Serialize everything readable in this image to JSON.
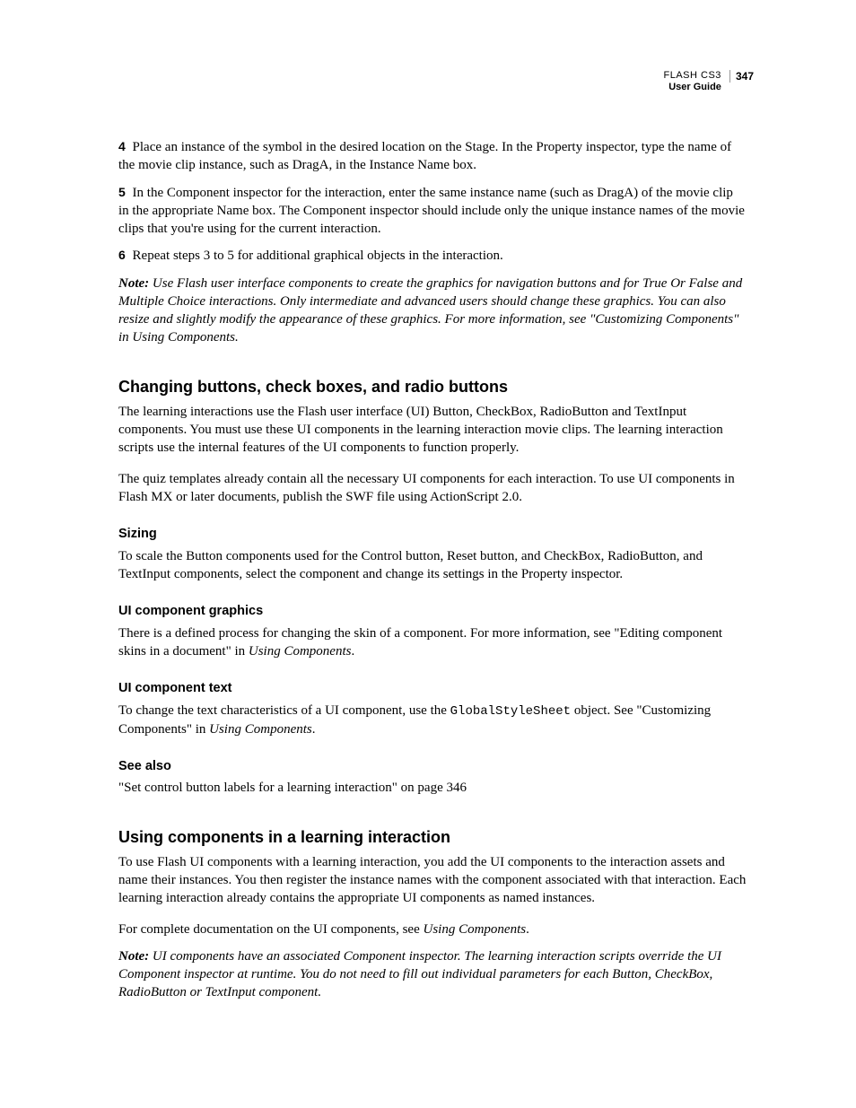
{
  "header": {
    "product": "FLASH CS3",
    "page_number": "347",
    "guide": "User Guide"
  },
  "steps": {
    "s4": {
      "num": "4",
      "text": "Place an instance of the symbol in the desired location on the Stage. In the Property inspector, type the name of the movie clip instance, such as DragA, in the Instance Name box."
    },
    "s5": {
      "num": "5",
      "text": "In the Component inspector for the interaction, enter the same instance name (such as DragA) of the movie clip in the appropriate Name box. The Component inspector should include only the unique instance names of the movie clips that you're using for the current interaction."
    },
    "s6": {
      "num": "6",
      "text": "Repeat steps 3 to 5 for additional graphical objects in the interaction."
    }
  },
  "note1": {
    "label": "Note:",
    "text": " Use Flash user interface components to create the graphics for navigation buttons and for True Or False and Multiple Choice interactions. Only intermediate and advanced users should change these graphics. You can also resize and slightly modify the appearance of these graphics. For more information, see \"Customizing Components\" in Using Components."
  },
  "section_changing": {
    "heading": "Changing buttons, check boxes, and radio buttons",
    "p1": "The learning interactions use the Flash user interface (UI) Button, CheckBox, RadioButton and TextInput components. You must use these UI components in the learning interaction movie clips. The learning interaction scripts use the internal features of the UI components to function properly.",
    "p2": "The quiz templates already contain all the necessary UI components for each interaction. To use UI components in Flash MX or later documents, publish the SWF file using ActionScript 2.0."
  },
  "sizing": {
    "heading": "Sizing",
    "p": "To scale the Button components used for the Control button, Reset button, and CheckBox, RadioButton, and TextInput components, select the component and change its settings in the Property inspector."
  },
  "graphics": {
    "heading": "UI component graphics",
    "p_pre": "There is a defined process for changing the skin of a component. For more information, see \"Editing component skins in a document\" in ",
    "p_ital": "Using Components",
    "p_post": "."
  },
  "text_sec": {
    "heading": "UI component text",
    "p_pre": "To change the text characteristics of a UI component, use the ",
    "code": "GlobalStyleSheet",
    "p_mid": " object. See \"Customizing Components\" in ",
    "p_ital": "Using Components",
    "p_post": "."
  },
  "see_also": {
    "heading": "See also",
    "link": "\"Set control button labels for a learning interaction\" on page 346"
  },
  "using": {
    "heading": "Using components in a learning interaction",
    "p1": "To use Flash UI components with a learning interaction, you add the UI components to the interaction assets and name their instances. You then register the instance names with the component associated with that interaction. Each learning interaction already contains the appropriate UI components as named instances.",
    "p2_pre": "For complete documentation on the UI components, see ",
    "p2_ital": "Using Components",
    "p2_post": "."
  },
  "note2": {
    "label": "Note:",
    "text": " UI components have an associated Component inspector. The learning interaction scripts override the UI Component inspector at runtime. You do not need to fill out individual parameters for each Button, CheckBox, RadioButton or TextInput component."
  }
}
